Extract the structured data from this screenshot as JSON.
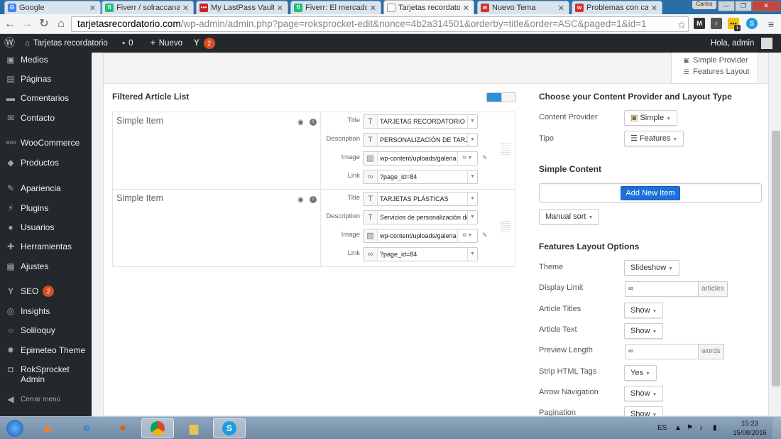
{
  "browser": {
    "tabs": [
      {
        "title": "Google",
        "color": "#4285f4",
        "glyph": "G"
      },
      {
        "title": "Fiverr / solraccanaria",
        "color": "#1dbf73",
        "glyph": "fi"
      },
      {
        "title": "My LastPass Vault",
        "color": "#cc2029",
        "glyph": "•••"
      },
      {
        "title": "Fiverr: El mercado p",
        "color": "#1dbf73",
        "glyph": "fi"
      },
      {
        "title": "Tarjetas recordatorio",
        "color": "#bbbbbb",
        "glyph": ""
      },
      {
        "title": "Nuevo Tema",
        "color": "#d0332b",
        "glyph": "w"
      },
      {
        "title": "Problemas con cam",
        "color": "#d0332b",
        "glyph": "w"
      }
    ],
    "profile_name": "Carlos",
    "url_host": "tarjetasrecordatorio.com",
    "url_path": "/wp-admin/admin.php?page=roksprocket-edit&nonce=4b2a314501&orderby=title&order=ASC&paged=1&id=1",
    "ext_badge": "1"
  },
  "adminbar": {
    "site_name": "Tarjetas recordatorio",
    "comments_count": "0",
    "new_label": "Nuevo",
    "seo_count": "2",
    "greeting": "Hola, admin"
  },
  "sidebar": {
    "items": [
      {
        "label": "Medios",
        "icon": "media-icon"
      },
      {
        "label": "Páginas",
        "icon": "pages-icon"
      },
      {
        "label": "Comentarios",
        "icon": "comments-icon"
      },
      {
        "label": "Contacto",
        "icon": "mail-icon"
      },
      {
        "label": "WooCommerce",
        "icon": "woocommerce-icon"
      },
      {
        "label": "Productos",
        "icon": "products-icon"
      },
      {
        "label": "Apariencia",
        "icon": "appearance-icon"
      },
      {
        "label": "Plugins",
        "icon": "plugins-icon"
      },
      {
        "label": "Usuarios",
        "icon": "users-icon"
      },
      {
        "label": "Herramientas",
        "icon": "tools-icon"
      },
      {
        "label": "Ajustes",
        "icon": "settings-icon"
      },
      {
        "label": "SEO",
        "icon": "seo-icon",
        "badge": "2"
      },
      {
        "label": "Insights",
        "icon": "insights-icon"
      },
      {
        "label": "Soliloquy",
        "icon": "soliloquy-icon"
      },
      {
        "label": "Epimeteo Theme",
        "icon": "gear-icon"
      },
      {
        "label": "RokSprocket Admin",
        "icon": "roksprocket-icon"
      }
    ],
    "collapse_label": "Cerrar menú"
  },
  "legend": {
    "provider": "Simple Provider",
    "layout": "Features Layout"
  },
  "article_list": {
    "title": "Filtered Article List",
    "field_labels": {
      "title": "Title",
      "description": "Description",
      "image": "Image",
      "link": "Link"
    },
    "items": [
      {
        "name": "Simple Item",
        "title_value": "TARJETAS RECORDATORIO",
        "description_value": "PERSONALIZACIÓN DE TARJ",
        "image_value": "wp-content/uploads/galeria",
        "link_value": "?page_id=84"
      },
      {
        "name": "Simple Item",
        "title_value": "TARJETAS PLÁSTICAS",
        "description_value": "Servicios de personalización de",
        "image_value": "wp-content/uploads/galeria",
        "link_value": "?page_id=84"
      }
    ]
  },
  "provider_panel": {
    "title": "Choose your Content Provider and Layout Type",
    "provider_label": "Content Provider",
    "provider_value": "Simple",
    "type_label": "Tipo",
    "type_value": "Features"
  },
  "simple_content": {
    "title": "Simple Content",
    "add_button": "Add New Item",
    "sort_button": "Manual sort"
  },
  "layout_options": {
    "title": "Features Layout Options",
    "theme_label": "Theme",
    "theme_value": "Slideshow",
    "limit_label": "Display Limit",
    "limit_value": "∞",
    "limit_suffix": "articles",
    "titles_label": "Article Titles",
    "titles_value": "Show",
    "text_label": "Article Text",
    "text_value": "Show",
    "preview_label": "Preview Length",
    "preview_value": "∞",
    "preview_suffix": "words",
    "strip_label": "Strip HTML Tags",
    "strip_value": "Yes",
    "arrow_label": "Arrow Navigation",
    "arrow_value": "Show",
    "pagination_label": "Pagination",
    "pagination_value": "Show"
  },
  "taskbar": {
    "language": "ES",
    "time": "15:23",
    "date": "15/08/2016"
  }
}
